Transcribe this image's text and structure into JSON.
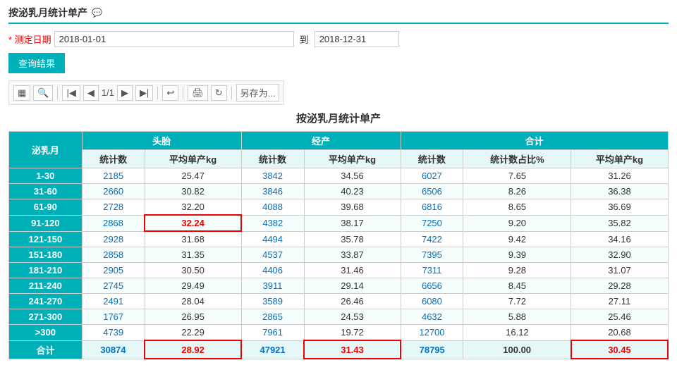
{
  "title": "按泌乳月统计单产",
  "filter": {
    "label": "* 测定日期",
    "start_value": "2018-01-01",
    "end_value": "2018-12-31",
    "separator": "到"
  },
  "query_button": "查询结果",
  "toolbar": {
    "page_info": "1/1",
    "save_as": "另存为..."
  },
  "report_title": "按泌乳月统计单产",
  "table": {
    "col_groups": [
      {
        "label": "泌乳月",
        "colspan": 1
      },
      {
        "label": "头胎",
        "colspan": 2
      },
      {
        "label": "经产",
        "colspan": 2
      },
      {
        "label": "合计",
        "colspan": 3
      }
    ],
    "sub_headers": [
      "泌乳月",
      "统计数",
      "平均单产kg",
      "统计数",
      "平均单产kg",
      "统计数",
      "统计数占比%",
      "平均单产kg"
    ],
    "rows": [
      {
        "label": "1-30",
        "h_count": "2185",
        "h_avg": "25.47",
        "e_count": "3842",
        "e_avg": "34.56",
        "t_count": "6027",
        "t_pct": "7.65",
        "t_avg": "31.26",
        "highlight_h_avg": false,
        "highlight_e_avg": false,
        "highlight_t_avg": false
      },
      {
        "label": "31-60",
        "h_count": "2660",
        "h_avg": "30.82",
        "e_count": "3846",
        "e_avg": "40.23",
        "t_count": "6506",
        "t_pct": "8.26",
        "t_avg": "36.38",
        "highlight_h_avg": false,
        "highlight_e_avg": false,
        "highlight_t_avg": false
      },
      {
        "label": "61-90",
        "h_count": "2728",
        "h_avg": "32.20",
        "e_count": "4088",
        "e_avg": "39.68",
        "t_count": "6816",
        "t_pct": "8.65",
        "t_avg": "36.69",
        "highlight_h_avg": false,
        "highlight_e_avg": false,
        "highlight_t_avg": false
      },
      {
        "label": "91-120",
        "h_count": "2868",
        "h_avg": "32.24",
        "e_count": "4382",
        "e_avg": "38.17",
        "t_count": "7250",
        "t_pct": "9.20",
        "t_avg": "35.82",
        "highlight_h_avg": true,
        "highlight_e_avg": false,
        "highlight_t_avg": false
      },
      {
        "label": "121-150",
        "h_count": "2928",
        "h_avg": "31.68",
        "e_count": "4494",
        "e_avg": "35.78",
        "t_count": "7422",
        "t_pct": "9.42",
        "t_avg": "34.16",
        "highlight_h_avg": false,
        "highlight_e_avg": false,
        "highlight_t_avg": false
      },
      {
        "label": "151-180",
        "h_count": "2858",
        "h_avg": "31.35",
        "e_count": "4537",
        "e_avg": "33.87",
        "t_count": "7395",
        "t_pct": "9.39",
        "t_avg": "32.90",
        "highlight_h_avg": false,
        "highlight_e_avg": false,
        "highlight_t_avg": false
      },
      {
        "label": "181-210",
        "h_count": "2905",
        "h_avg": "30.50",
        "e_count": "4406",
        "e_avg": "31.46",
        "t_count": "7311",
        "t_pct": "9.28",
        "t_avg": "31.07",
        "highlight_h_avg": false,
        "highlight_e_avg": false,
        "highlight_t_avg": false
      },
      {
        "label": "211-240",
        "h_count": "2745",
        "h_avg": "29.49",
        "e_count": "3911",
        "e_avg": "29.14",
        "t_count": "6656",
        "t_pct": "8.45",
        "t_avg": "29.28",
        "highlight_h_avg": false,
        "highlight_e_avg": false,
        "highlight_t_avg": false
      },
      {
        "label": "241-270",
        "h_count": "2491",
        "h_avg": "28.04",
        "e_count": "3589",
        "e_avg": "26.46",
        "t_count": "6080",
        "t_pct": "7.72",
        "t_avg": "27.11",
        "highlight_h_avg": false,
        "highlight_e_avg": false,
        "highlight_t_avg": false
      },
      {
        "label": "271-300",
        "h_count": "1767",
        "h_avg": "26.95",
        "e_count": "2865",
        "e_avg": "24.53",
        "t_count": "4632",
        "t_pct": "5.88",
        "t_avg": "25.46",
        "highlight_h_avg": false,
        "highlight_e_avg": false,
        "highlight_t_avg": false
      },
      {
        "label": ">300",
        "h_count": "4739",
        "h_avg": "22.29",
        "e_count": "7961",
        "e_avg": "19.72",
        "t_count": "12700",
        "t_pct": "16.12",
        "t_avg": "20.68",
        "highlight_h_avg": false,
        "highlight_e_avg": false,
        "highlight_t_avg": false
      }
    ],
    "total_row": {
      "label": "合计",
      "h_count": "30874",
      "h_avg": "28.92",
      "e_count": "47921",
      "e_avg": "31.43",
      "t_count": "78795",
      "t_pct": "100.00",
      "t_avg": "30.45"
    }
  }
}
